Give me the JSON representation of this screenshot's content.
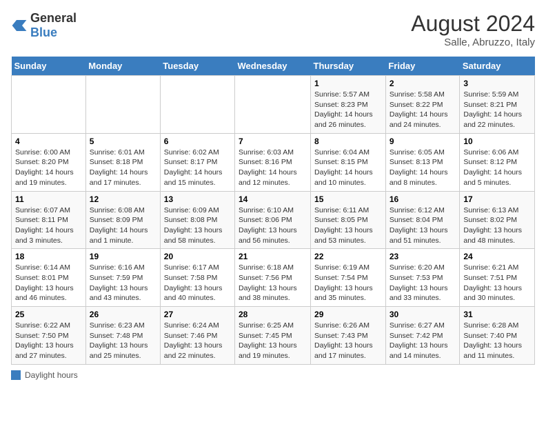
{
  "header": {
    "logo_general": "General",
    "logo_blue": "Blue",
    "month_year": "August 2024",
    "location": "Salle, Abruzzo, Italy"
  },
  "days_of_week": [
    "Sunday",
    "Monday",
    "Tuesday",
    "Wednesday",
    "Thursday",
    "Friday",
    "Saturday"
  ],
  "weeks": [
    [
      {
        "day": "",
        "sunrise": "",
        "sunset": "",
        "daylight": ""
      },
      {
        "day": "",
        "sunrise": "",
        "sunset": "",
        "daylight": ""
      },
      {
        "day": "",
        "sunrise": "",
        "sunset": "",
        "daylight": ""
      },
      {
        "day": "",
        "sunrise": "",
        "sunset": "",
        "daylight": ""
      },
      {
        "day": "1",
        "sunrise": "5:57 AM",
        "sunset": "8:23 PM",
        "daylight": "14 hours and 26 minutes."
      },
      {
        "day": "2",
        "sunrise": "5:58 AM",
        "sunset": "8:22 PM",
        "daylight": "14 hours and 24 minutes."
      },
      {
        "day": "3",
        "sunrise": "5:59 AM",
        "sunset": "8:21 PM",
        "daylight": "14 hours and 22 minutes."
      }
    ],
    [
      {
        "day": "4",
        "sunrise": "6:00 AM",
        "sunset": "8:20 PM",
        "daylight": "14 hours and 19 minutes."
      },
      {
        "day": "5",
        "sunrise": "6:01 AM",
        "sunset": "8:18 PM",
        "daylight": "14 hours and 17 minutes."
      },
      {
        "day": "6",
        "sunrise": "6:02 AM",
        "sunset": "8:17 PM",
        "daylight": "14 hours and 15 minutes."
      },
      {
        "day": "7",
        "sunrise": "6:03 AM",
        "sunset": "8:16 PM",
        "daylight": "14 hours and 12 minutes."
      },
      {
        "day": "8",
        "sunrise": "6:04 AM",
        "sunset": "8:15 PM",
        "daylight": "14 hours and 10 minutes."
      },
      {
        "day": "9",
        "sunrise": "6:05 AM",
        "sunset": "8:13 PM",
        "daylight": "14 hours and 8 minutes."
      },
      {
        "day": "10",
        "sunrise": "6:06 AM",
        "sunset": "8:12 PM",
        "daylight": "14 hours and 5 minutes."
      }
    ],
    [
      {
        "day": "11",
        "sunrise": "6:07 AM",
        "sunset": "8:11 PM",
        "daylight": "14 hours and 3 minutes."
      },
      {
        "day": "12",
        "sunrise": "6:08 AM",
        "sunset": "8:09 PM",
        "daylight": "14 hours and 1 minute."
      },
      {
        "day": "13",
        "sunrise": "6:09 AM",
        "sunset": "8:08 PM",
        "daylight": "13 hours and 58 minutes."
      },
      {
        "day": "14",
        "sunrise": "6:10 AM",
        "sunset": "8:06 PM",
        "daylight": "13 hours and 56 minutes."
      },
      {
        "day": "15",
        "sunrise": "6:11 AM",
        "sunset": "8:05 PM",
        "daylight": "13 hours and 53 minutes."
      },
      {
        "day": "16",
        "sunrise": "6:12 AM",
        "sunset": "8:04 PM",
        "daylight": "13 hours and 51 minutes."
      },
      {
        "day": "17",
        "sunrise": "6:13 AM",
        "sunset": "8:02 PM",
        "daylight": "13 hours and 48 minutes."
      }
    ],
    [
      {
        "day": "18",
        "sunrise": "6:14 AM",
        "sunset": "8:01 PM",
        "daylight": "13 hours and 46 minutes."
      },
      {
        "day": "19",
        "sunrise": "6:16 AM",
        "sunset": "7:59 PM",
        "daylight": "13 hours and 43 minutes."
      },
      {
        "day": "20",
        "sunrise": "6:17 AM",
        "sunset": "7:58 PM",
        "daylight": "13 hours and 40 minutes."
      },
      {
        "day": "21",
        "sunrise": "6:18 AM",
        "sunset": "7:56 PM",
        "daylight": "13 hours and 38 minutes."
      },
      {
        "day": "22",
        "sunrise": "6:19 AM",
        "sunset": "7:54 PM",
        "daylight": "13 hours and 35 minutes."
      },
      {
        "day": "23",
        "sunrise": "6:20 AM",
        "sunset": "7:53 PM",
        "daylight": "13 hours and 33 minutes."
      },
      {
        "day": "24",
        "sunrise": "6:21 AM",
        "sunset": "7:51 PM",
        "daylight": "13 hours and 30 minutes."
      }
    ],
    [
      {
        "day": "25",
        "sunrise": "6:22 AM",
        "sunset": "7:50 PM",
        "daylight": "13 hours and 27 minutes."
      },
      {
        "day": "26",
        "sunrise": "6:23 AM",
        "sunset": "7:48 PM",
        "daylight": "13 hours and 25 minutes."
      },
      {
        "day": "27",
        "sunrise": "6:24 AM",
        "sunset": "7:46 PM",
        "daylight": "13 hours and 22 minutes."
      },
      {
        "day": "28",
        "sunrise": "6:25 AM",
        "sunset": "7:45 PM",
        "daylight": "13 hours and 19 minutes."
      },
      {
        "day": "29",
        "sunrise": "6:26 AM",
        "sunset": "7:43 PM",
        "daylight": "13 hours and 17 minutes."
      },
      {
        "day": "30",
        "sunrise": "6:27 AM",
        "sunset": "7:42 PM",
        "daylight": "13 hours and 14 minutes."
      },
      {
        "day": "31",
        "sunrise": "6:28 AM",
        "sunset": "7:40 PM",
        "daylight": "13 hours and 11 minutes."
      }
    ]
  ],
  "legend": {
    "label": "Daylight hours"
  }
}
